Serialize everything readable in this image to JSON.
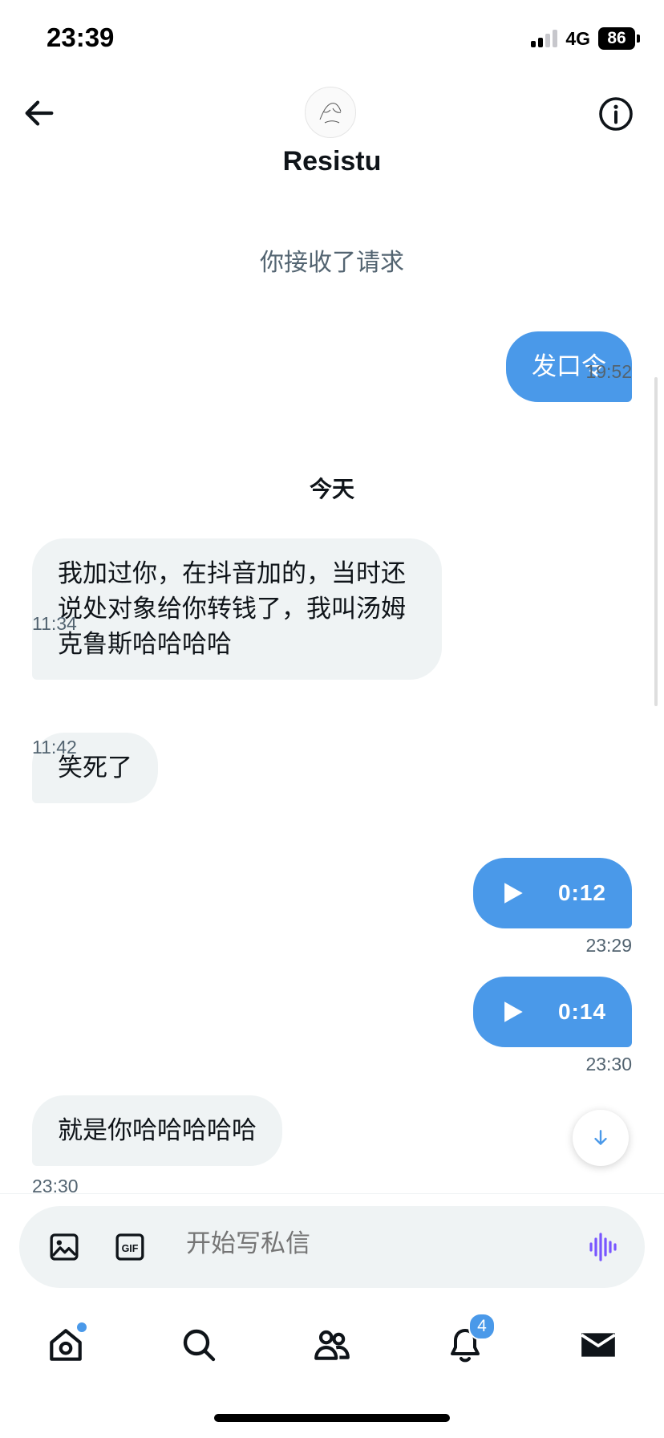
{
  "status_bar": {
    "time": "23:39",
    "network": "4G",
    "battery": "86"
  },
  "header": {
    "title": "Resistu",
    "back_icon": "arrow-left-icon",
    "info_icon": "info-icon"
  },
  "system_notice": "你接收了请求",
  "day_divider": "今天",
  "messages": [
    {
      "direction": "out",
      "type": "text",
      "text": "发口令",
      "time": "19:52"
    },
    {
      "direction": "in",
      "type": "text",
      "text": "我加过你，在抖音加的，当时还说处对象给你转钱了，我叫汤姆克鲁斯哈哈哈哈",
      "time": "11:34"
    },
    {
      "direction": "in",
      "type": "text",
      "text": "笑死了",
      "time": "11:42"
    },
    {
      "direction": "out",
      "type": "voice",
      "duration": "0:12",
      "time": "23:29"
    },
    {
      "direction": "out",
      "type": "voice",
      "duration": "0:14",
      "time": "23:30"
    },
    {
      "direction": "in",
      "type": "text",
      "text": "就是你哈哈哈哈哈",
      "time": "23:30"
    }
  ],
  "composer": {
    "placeholder": "开始写私信",
    "icons": [
      "image-icon",
      "gif-icon",
      "voice-wave-icon"
    ],
    "gif_label": "GIF"
  },
  "tabbar": {
    "items": [
      "home-icon",
      "search-icon",
      "communities-icon",
      "bell-icon",
      "mail-icon"
    ],
    "notification_count": "4"
  },
  "colors": {
    "accent": "#4a99e9",
    "bubble_in": "#eff3f4",
    "muted_text": "#536471"
  }
}
